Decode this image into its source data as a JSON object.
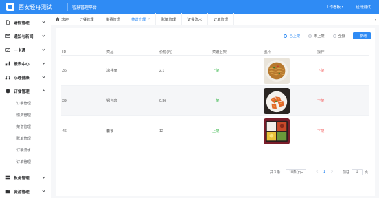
{
  "header": {
    "app_name": "西安轻舟测试",
    "system_title": "智慧管理平台",
    "workbench_label": "工作看板",
    "user_label": "轻舟测试"
  },
  "sidebar": {
    "items": [
      {
        "label": "请假管理",
        "icon": "file-icon"
      },
      {
        "label": "通知与新闻",
        "icon": "mail-icon"
      },
      {
        "label": "一卡通",
        "icon": "card-icon"
      },
      {
        "label": "报表中心",
        "icon": "report-icon"
      },
      {
        "label": "心理健康",
        "icon": "headset-icon"
      },
      {
        "label": "订餐管理",
        "icon": "database-icon"
      }
    ],
    "sub_items": [
      "订餐管理",
      "缴费管理",
      "菜谱管理",
      "账单管理",
      "订餐流水",
      "订单管理"
    ],
    "bottom_items": [
      {
        "label": "教务管理",
        "icon": "grid-icon"
      },
      {
        "label": "资源管理",
        "icon": "folder-icon"
      }
    ]
  },
  "tabs": [
    {
      "label": "欢迎"
    },
    {
      "label": "订餐管理"
    },
    {
      "label": "缴费管理"
    },
    {
      "label": "菜谱管理"
    },
    {
      "label": "账单管理"
    },
    {
      "label": "订餐流水"
    },
    {
      "label": "订单管理"
    }
  ],
  "filters": {
    "options": [
      "已上架",
      "未上架",
      "全部"
    ],
    "selected": "已上架",
    "add_label": "+ 新增"
  },
  "table": {
    "columns": [
      "ID",
      "菜品",
      "价格(元)",
      "菜谱上架",
      "图片",
      "操作"
    ],
    "rows": [
      {
        "id": "36",
        "name": "凉拌面",
        "price": "2.1",
        "status": "上架",
        "image": "noodles",
        "action": "下架"
      },
      {
        "id": "39",
        "name": "锅包肉",
        "price": "0.36",
        "status": "上架",
        "image": "sweet-sour-pork",
        "action": "下架"
      },
      {
        "id": "46",
        "name": "套餐",
        "price": "12",
        "status": "上架",
        "image": "bento",
        "action": "下架"
      }
    ]
  },
  "pagination": {
    "total": "共 3 条",
    "page_size": "10条/页",
    "prev": "<",
    "current_page": "1",
    "next": ">",
    "goto_label": "前往",
    "goto_value": "1",
    "goto_suffix": "页"
  },
  "colors": {
    "primary": "#2f8bf4",
    "status_on": "#3fb950",
    "action_off": "#f56c6c"
  }
}
